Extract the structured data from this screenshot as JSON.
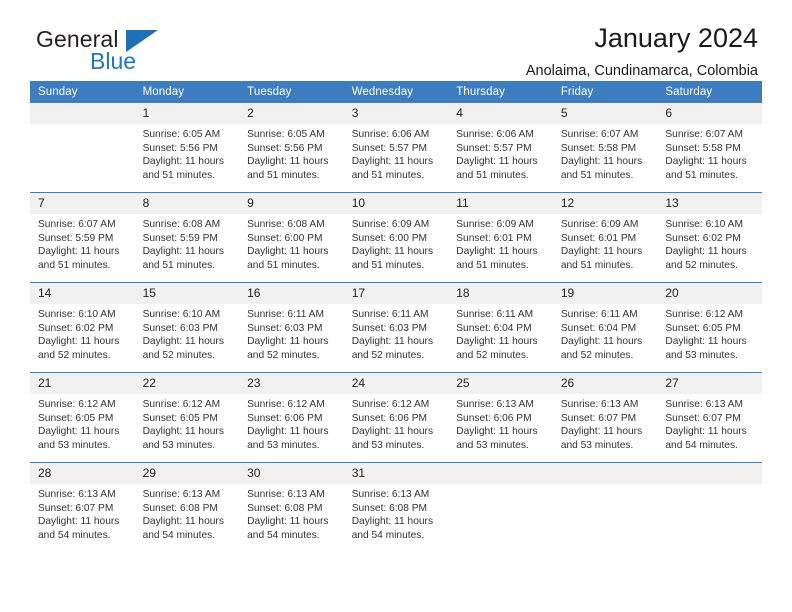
{
  "brand": {
    "name_part1": "General",
    "name_part2": "Blue",
    "triangle_color": "#1f6fb4",
    "blue_color": "#1f77c4"
  },
  "header": {
    "title": "January 2024",
    "subtitle": "Anolaima, Cundinamarca, Colombia"
  },
  "calendar": {
    "header_bg": "#3c7cbf",
    "daynum_bg": "#f0f0f0",
    "weekdays": [
      "Sunday",
      "Monday",
      "Tuesday",
      "Wednesday",
      "Thursday",
      "Friday",
      "Saturday"
    ],
    "weeks": [
      [
        {
          "day": "",
          "sunrise": "",
          "sunset": "",
          "daylight_line1": "",
          "daylight_line2": "",
          "empty": true
        },
        {
          "day": "1",
          "sunrise": "Sunrise: 6:05 AM",
          "sunset": "Sunset: 5:56 PM",
          "daylight_line1": "Daylight: 11 hours",
          "daylight_line2": "and 51 minutes."
        },
        {
          "day": "2",
          "sunrise": "Sunrise: 6:05 AM",
          "sunset": "Sunset: 5:56 PM",
          "daylight_line1": "Daylight: 11 hours",
          "daylight_line2": "and 51 minutes."
        },
        {
          "day": "3",
          "sunrise": "Sunrise: 6:06 AM",
          "sunset": "Sunset: 5:57 PM",
          "daylight_line1": "Daylight: 11 hours",
          "daylight_line2": "and 51 minutes."
        },
        {
          "day": "4",
          "sunrise": "Sunrise: 6:06 AM",
          "sunset": "Sunset: 5:57 PM",
          "daylight_line1": "Daylight: 11 hours",
          "daylight_line2": "and 51 minutes."
        },
        {
          "day": "5",
          "sunrise": "Sunrise: 6:07 AM",
          "sunset": "Sunset: 5:58 PM",
          "daylight_line1": "Daylight: 11 hours",
          "daylight_line2": "and 51 minutes."
        },
        {
          "day": "6",
          "sunrise": "Sunrise: 6:07 AM",
          "sunset": "Sunset: 5:58 PM",
          "daylight_line1": "Daylight: 11 hours",
          "daylight_line2": "and 51 minutes."
        }
      ],
      [
        {
          "day": "7",
          "sunrise": "Sunrise: 6:07 AM",
          "sunset": "Sunset: 5:59 PM",
          "daylight_line1": "Daylight: 11 hours",
          "daylight_line2": "and 51 minutes."
        },
        {
          "day": "8",
          "sunrise": "Sunrise: 6:08 AM",
          "sunset": "Sunset: 5:59 PM",
          "daylight_line1": "Daylight: 11 hours",
          "daylight_line2": "and 51 minutes."
        },
        {
          "day": "9",
          "sunrise": "Sunrise: 6:08 AM",
          "sunset": "Sunset: 6:00 PM",
          "daylight_line1": "Daylight: 11 hours",
          "daylight_line2": "and 51 minutes."
        },
        {
          "day": "10",
          "sunrise": "Sunrise: 6:09 AM",
          "sunset": "Sunset: 6:00 PM",
          "daylight_line1": "Daylight: 11 hours",
          "daylight_line2": "and 51 minutes."
        },
        {
          "day": "11",
          "sunrise": "Sunrise: 6:09 AM",
          "sunset": "Sunset: 6:01 PM",
          "daylight_line1": "Daylight: 11 hours",
          "daylight_line2": "and 51 minutes."
        },
        {
          "day": "12",
          "sunrise": "Sunrise: 6:09 AM",
          "sunset": "Sunset: 6:01 PM",
          "daylight_line1": "Daylight: 11 hours",
          "daylight_line2": "and 51 minutes."
        },
        {
          "day": "13",
          "sunrise": "Sunrise: 6:10 AM",
          "sunset": "Sunset: 6:02 PM",
          "daylight_line1": "Daylight: 11 hours",
          "daylight_line2": "and 52 minutes."
        }
      ],
      [
        {
          "day": "14",
          "sunrise": "Sunrise: 6:10 AM",
          "sunset": "Sunset: 6:02 PM",
          "daylight_line1": "Daylight: 11 hours",
          "daylight_line2": "and 52 minutes."
        },
        {
          "day": "15",
          "sunrise": "Sunrise: 6:10 AM",
          "sunset": "Sunset: 6:03 PM",
          "daylight_line1": "Daylight: 11 hours",
          "daylight_line2": "and 52 minutes."
        },
        {
          "day": "16",
          "sunrise": "Sunrise: 6:11 AM",
          "sunset": "Sunset: 6:03 PM",
          "daylight_line1": "Daylight: 11 hours",
          "daylight_line2": "and 52 minutes."
        },
        {
          "day": "17",
          "sunrise": "Sunrise: 6:11 AM",
          "sunset": "Sunset: 6:03 PM",
          "daylight_line1": "Daylight: 11 hours",
          "daylight_line2": "and 52 minutes."
        },
        {
          "day": "18",
          "sunrise": "Sunrise: 6:11 AM",
          "sunset": "Sunset: 6:04 PM",
          "daylight_line1": "Daylight: 11 hours",
          "daylight_line2": "and 52 minutes."
        },
        {
          "day": "19",
          "sunrise": "Sunrise: 6:11 AM",
          "sunset": "Sunset: 6:04 PM",
          "daylight_line1": "Daylight: 11 hours",
          "daylight_line2": "and 52 minutes."
        },
        {
          "day": "20",
          "sunrise": "Sunrise: 6:12 AM",
          "sunset": "Sunset: 6:05 PM",
          "daylight_line1": "Daylight: 11 hours",
          "daylight_line2": "and 53 minutes."
        }
      ],
      [
        {
          "day": "21",
          "sunrise": "Sunrise: 6:12 AM",
          "sunset": "Sunset: 6:05 PM",
          "daylight_line1": "Daylight: 11 hours",
          "daylight_line2": "and 53 minutes."
        },
        {
          "day": "22",
          "sunrise": "Sunrise: 6:12 AM",
          "sunset": "Sunset: 6:05 PM",
          "daylight_line1": "Daylight: 11 hours",
          "daylight_line2": "and 53 minutes."
        },
        {
          "day": "23",
          "sunrise": "Sunrise: 6:12 AM",
          "sunset": "Sunset: 6:06 PM",
          "daylight_line1": "Daylight: 11 hours",
          "daylight_line2": "and 53 minutes."
        },
        {
          "day": "24",
          "sunrise": "Sunrise: 6:12 AM",
          "sunset": "Sunset: 6:06 PM",
          "daylight_line1": "Daylight: 11 hours",
          "daylight_line2": "and 53 minutes."
        },
        {
          "day": "25",
          "sunrise": "Sunrise: 6:13 AM",
          "sunset": "Sunset: 6:06 PM",
          "daylight_line1": "Daylight: 11 hours",
          "daylight_line2": "and 53 minutes."
        },
        {
          "day": "26",
          "sunrise": "Sunrise: 6:13 AM",
          "sunset": "Sunset: 6:07 PM",
          "daylight_line1": "Daylight: 11 hours",
          "daylight_line2": "and 53 minutes."
        },
        {
          "day": "27",
          "sunrise": "Sunrise: 6:13 AM",
          "sunset": "Sunset: 6:07 PM",
          "daylight_line1": "Daylight: 11 hours",
          "daylight_line2": "and 54 minutes."
        }
      ],
      [
        {
          "day": "28",
          "sunrise": "Sunrise: 6:13 AM",
          "sunset": "Sunset: 6:07 PM",
          "daylight_line1": "Daylight: 11 hours",
          "daylight_line2": "and 54 minutes."
        },
        {
          "day": "29",
          "sunrise": "Sunrise: 6:13 AM",
          "sunset": "Sunset: 6:08 PM",
          "daylight_line1": "Daylight: 11 hours",
          "daylight_line2": "and 54 minutes."
        },
        {
          "day": "30",
          "sunrise": "Sunrise: 6:13 AM",
          "sunset": "Sunset: 6:08 PM",
          "daylight_line1": "Daylight: 11 hours",
          "daylight_line2": "and 54 minutes."
        },
        {
          "day": "31",
          "sunrise": "Sunrise: 6:13 AM",
          "sunset": "Sunset: 6:08 PM",
          "daylight_line1": "Daylight: 11 hours",
          "daylight_line2": "and 54 minutes."
        },
        {
          "day": "",
          "sunrise": "",
          "sunset": "",
          "daylight_line1": "",
          "daylight_line2": "",
          "empty": true
        },
        {
          "day": "",
          "sunrise": "",
          "sunset": "",
          "daylight_line1": "",
          "daylight_line2": "",
          "empty": true
        },
        {
          "day": "",
          "sunrise": "",
          "sunset": "",
          "daylight_line1": "",
          "daylight_line2": "",
          "empty": true
        }
      ]
    ]
  }
}
